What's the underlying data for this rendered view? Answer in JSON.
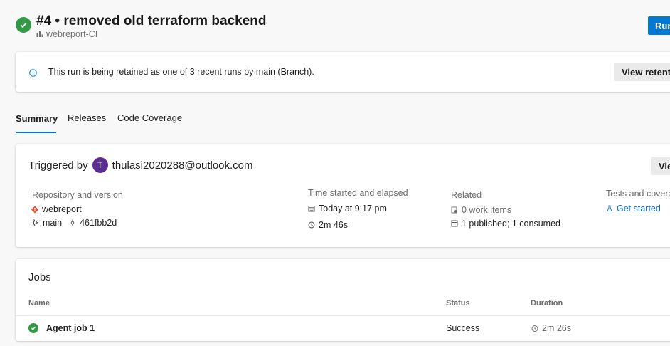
{
  "header": {
    "title": "#4 • removed old terraform backend",
    "pipeline": "webreport-CI",
    "run_button": "Run",
    "status_icon": "success-check-icon"
  },
  "banner": {
    "message": "This run is being retained as one of 3 recent runs by main (Branch).",
    "button": "View retention leases"
  },
  "tabs": [
    {
      "label": "Summary",
      "active": true
    },
    {
      "label": "Releases",
      "active": false
    },
    {
      "label": "Code Coverage",
      "active": false
    }
  ],
  "summary": {
    "triggered_prefix": "Triggered by",
    "avatar_initial": "T",
    "user": "thulasi2020288@outlook.com",
    "view_button": "View",
    "repo": {
      "label": "Repository and version",
      "name": "webreport",
      "branch": "main",
      "commit": "461fbb2d"
    },
    "time": {
      "label": "Time started and elapsed",
      "started": "Today at 9:17 pm",
      "elapsed": "2m 46s"
    },
    "related": {
      "label": "Related",
      "work_items": "0 work items",
      "artifacts": "1 published; 1 consumed"
    },
    "tests": {
      "label": "Tests and coverage",
      "link": "Get started"
    }
  },
  "jobs": {
    "title": "Jobs",
    "columns": {
      "name": "Name",
      "status": "Status",
      "duration": "Duration"
    },
    "rows": [
      {
        "name": "Agent job 1",
        "status": "Success",
        "duration": "2m 26s"
      }
    ]
  },
  "colors": {
    "accent": "#0078d4",
    "success": "#339947",
    "avatar": "#5c2e91",
    "git": "#e44e2c"
  }
}
